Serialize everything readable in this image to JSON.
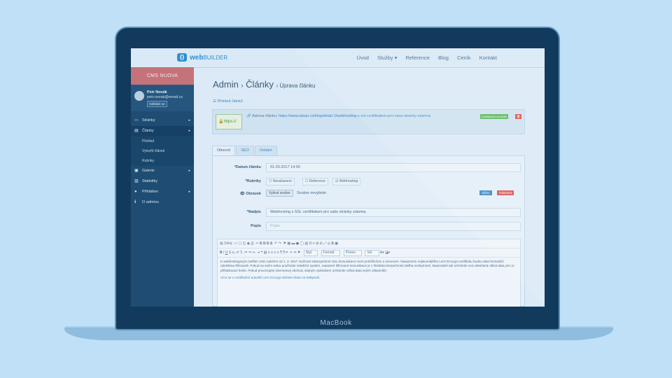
{
  "device": {
    "brand": "MacBook"
  },
  "colors": {
    "background": "#bfe0f7",
    "accent": "#2f8fd0",
    "sidebar": "#1e4c72",
    "cms_header": "#c4737a"
  },
  "topnav": {
    "logo_icon": "bracket-logo-icon",
    "logo_main": "web",
    "logo_suffix": "BUILDER",
    "links": [
      "Úvod",
      "Služby ▾",
      "Reference",
      "Blog",
      "Ceník",
      "Kontakt"
    ]
  },
  "sidebar": {
    "cms_label": "CMS NUOVA",
    "user": {
      "name": "Petr Novák",
      "email": "petr.novak@email.cz",
      "logout": "Odhlásit se"
    },
    "items": [
      {
        "label": "Stránky",
        "icon": "page-icon",
        "arrow": "▸"
      },
      {
        "label": "Články",
        "icon": "article-icon",
        "arrow": "▸",
        "active": true
      },
      {
        "label": "Galerie",
        "icon": "image-icon",
        "arrow": "▸"
      },
      {
        "label": "Statistiky",
        "icon": "chart-icon",
        "arrow": ""
      },
      {
        "label": "Přihlášen",
        "icon": "user-icon",
        "arrow": "▸"
      },
      {
        "label": "O adminu",
        "icon": "info-icon",
        "arrow": ""
      }
    ],
    "subitems": [
      "Přehled",
      "Vytvořit článek",
      "Rubriky"
    ]
  },
  "main": {
    "title": "Admin",
    "sep": "›",
    "title2": "Články",
    "subtitle": "› Úprava článku",
    "overview_link": "Přehled článků",
    "https_badge": "https://",
    "address_label": "Adresa článku:",
    "address_url": "https://www.atsan.cz/blog/detail-1/webhosting-s-ssl-certifikatem-pro-vase-stranky-zdarma",
    "published_btn": "Zveřejněno na webu",
    "delete_icon": "trash-icon",
    "tabs": [
      "Obecné",
      "SEO",
      "Ostatní"
    ],
    "form": {
      "date_label": "*Datum článku",
      "date_value": "01.03.2017 14:00",
      "rubriky_label": "*Rubriky",
      "rubriky": [
        "Nezařazeno",
        "Reference",
        "Webhosting"
      ],
      "image_label": "Obrázek",
      "image_btn": "Vybrat soubor",
      "image_text": "Soubor nevybrán",
      "choose_btn": "Výřez",
      "remove_btn": "Odstranit",
      "headline_label": "*Nadpis",
      "headline_value": "Webhosting s SSL certifikátem pro vaše stránky zdarma.",
      "desc_label": "Popis",
      "desc_placeholder": "Popis"
    },
    "editor": {
      "source": "Zdroj",
      "styles": "Styl",
      "format": "Formát",
      "font": "Písmo",
      "size": "Vel.",
      "paragraph1": "K webhostingovým tarifům Vám nabízím od 1. 3. 2017 možnost zabezpečené SSL komunikace mezi prohlížečem a serverem. Nasazením nejlacenějšího Let's Encrypt certifikátu budou data formulářů odesílána šifrovaně. Pokud na svém webu používáte redakční systém, nasazení šifrované komunikace je z hlediska bezpečnosti takřka nezbytností. Maximálně tak ochráníte svá odesílaná citlivá data jako je přihlašovací heslo. Pokud provozujete internetový obchod, stejným způsobem ochráníte citlivá data svých zákazníků.",
      "paragraph2": "Více se o certifikační autoritě Let's Encrypt dočtete třeba na Wikipedii."
    }
  }
}
